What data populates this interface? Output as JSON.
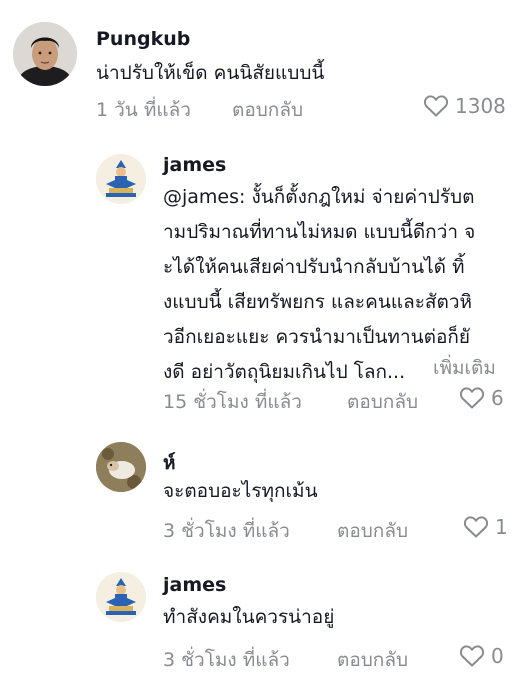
{
  "comments": [
    {
      "username": "Pungkub",
      "text": "น่าปรับให้เข็ด คนนิสัยแบบนี้",
      "time": "1 วัน ที่แล้ว",
      "reply_label": "ตอบกลับ",
      "likes": "1308",
      "avatar": "man-photo"
    },
    {
      "username": "james",
      "text_lines": [
        "@james: งั้นก็ตั้งกฎใหม่ จ่ายค่าปรับต",
        "ามปริมาณที่ทานไม่หมด แบบนี้ดีกว่า จ",
        "ะได้ให้คนเสียค่าปรับนำกลับบ้านได้ ทิ้",
        "งแบบนี้ เสียทรัพยกร และคนและสัตวหิ",
        "วอีกเยอะแยะ ควรนำมาเป็นทานต่อก็ยั",
        "งดี อย่าวัตถุนิยมเกินไป โลก..."
      ],
      "more_label": "เพิ่มเติม",
      "time": "15 ชั่วโมง ที่แล้ว",
      "reply_label": "ตอบกลับ",
      "likes": "6",
      "avatar": "deity-emblem"
    },
    {
      "username": "ห์",
      "text": "จะตอบอะไรทุกเม้น",
      "time": "3 ชั่วโมง ที่แล้ว",
      "reply_label": "ตอบกลับ",
      "likes": "1",
      "avatar": "dog-photo"
    },
    {
      "username": "james",
      "text": "ทำสังคมในควรน่าอยู่",
      "time": "3 ชั่วโมง ที่แล้ว",
      "reply_label": "ตอบกลับ",
      "likes": "0",
      "avatar": "deity-emblem"
    }
  ],
  "icons": {
    "like": "heart-outline-icon"
  },
  "colors": {
    "text": "#161823",
    "muted": "#8a8b91"
  }
}
